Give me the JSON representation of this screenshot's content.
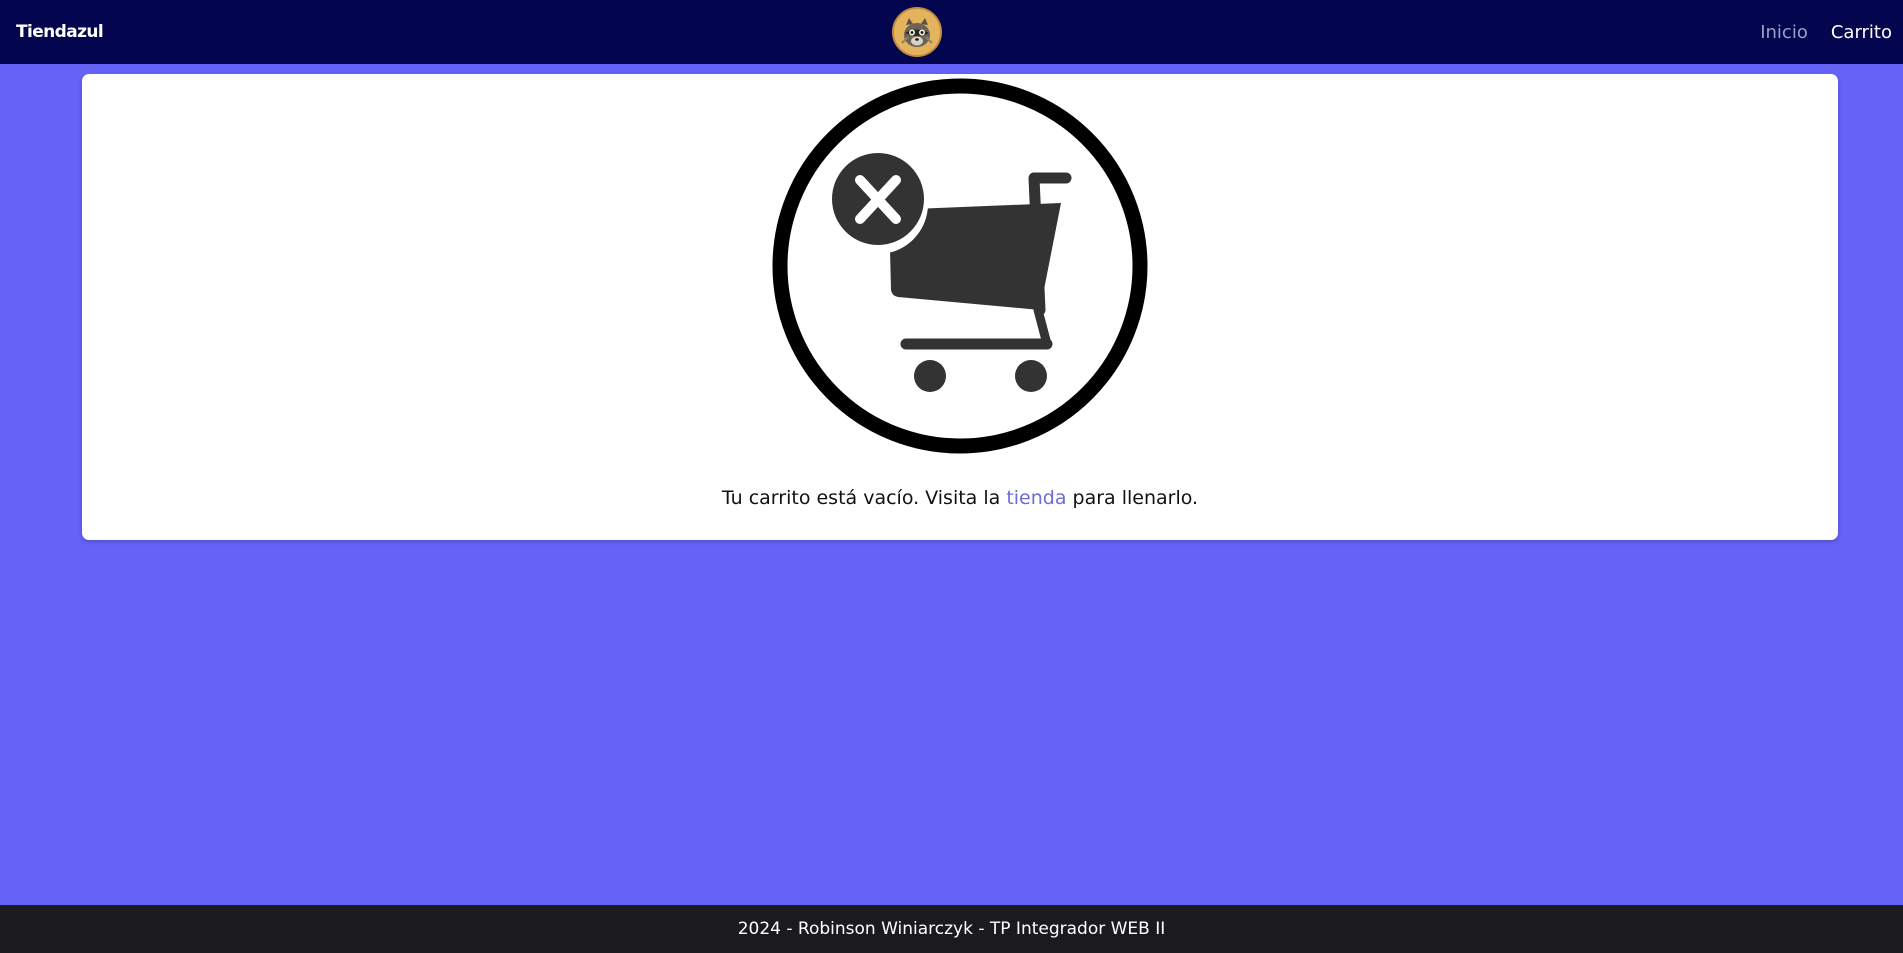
{
  "navbar": {
    "brand": "Tiendazul",
    "logo_icon": "raccoon-avatar-icon",
    "links": [
      {
        "label": "Inicio",
        "state": "inactive"
      },
      {
        "label": "Carrito",
        "state": "active"
      }
    ]
  },
  "cart": {
    "illustration_icon": "empty-cart-icon",
    "message_before": "Tu carrito está vacío. Visita la ",
    "message_link": "tienda",
    "message_after": " para llenarlo."
  },
  "footer": {
    "text": "2024 - Robinson Winiarczyk - TP Integrador WEB II"
  },
  "colors": {
    "page_background": "#6462f7",
    "navbar_background": "#03064e",
    "footer_background": "#1b1b1e",
    "link_color": "#6e6bd9",
    "icon_color": "#333333"
  }
}
